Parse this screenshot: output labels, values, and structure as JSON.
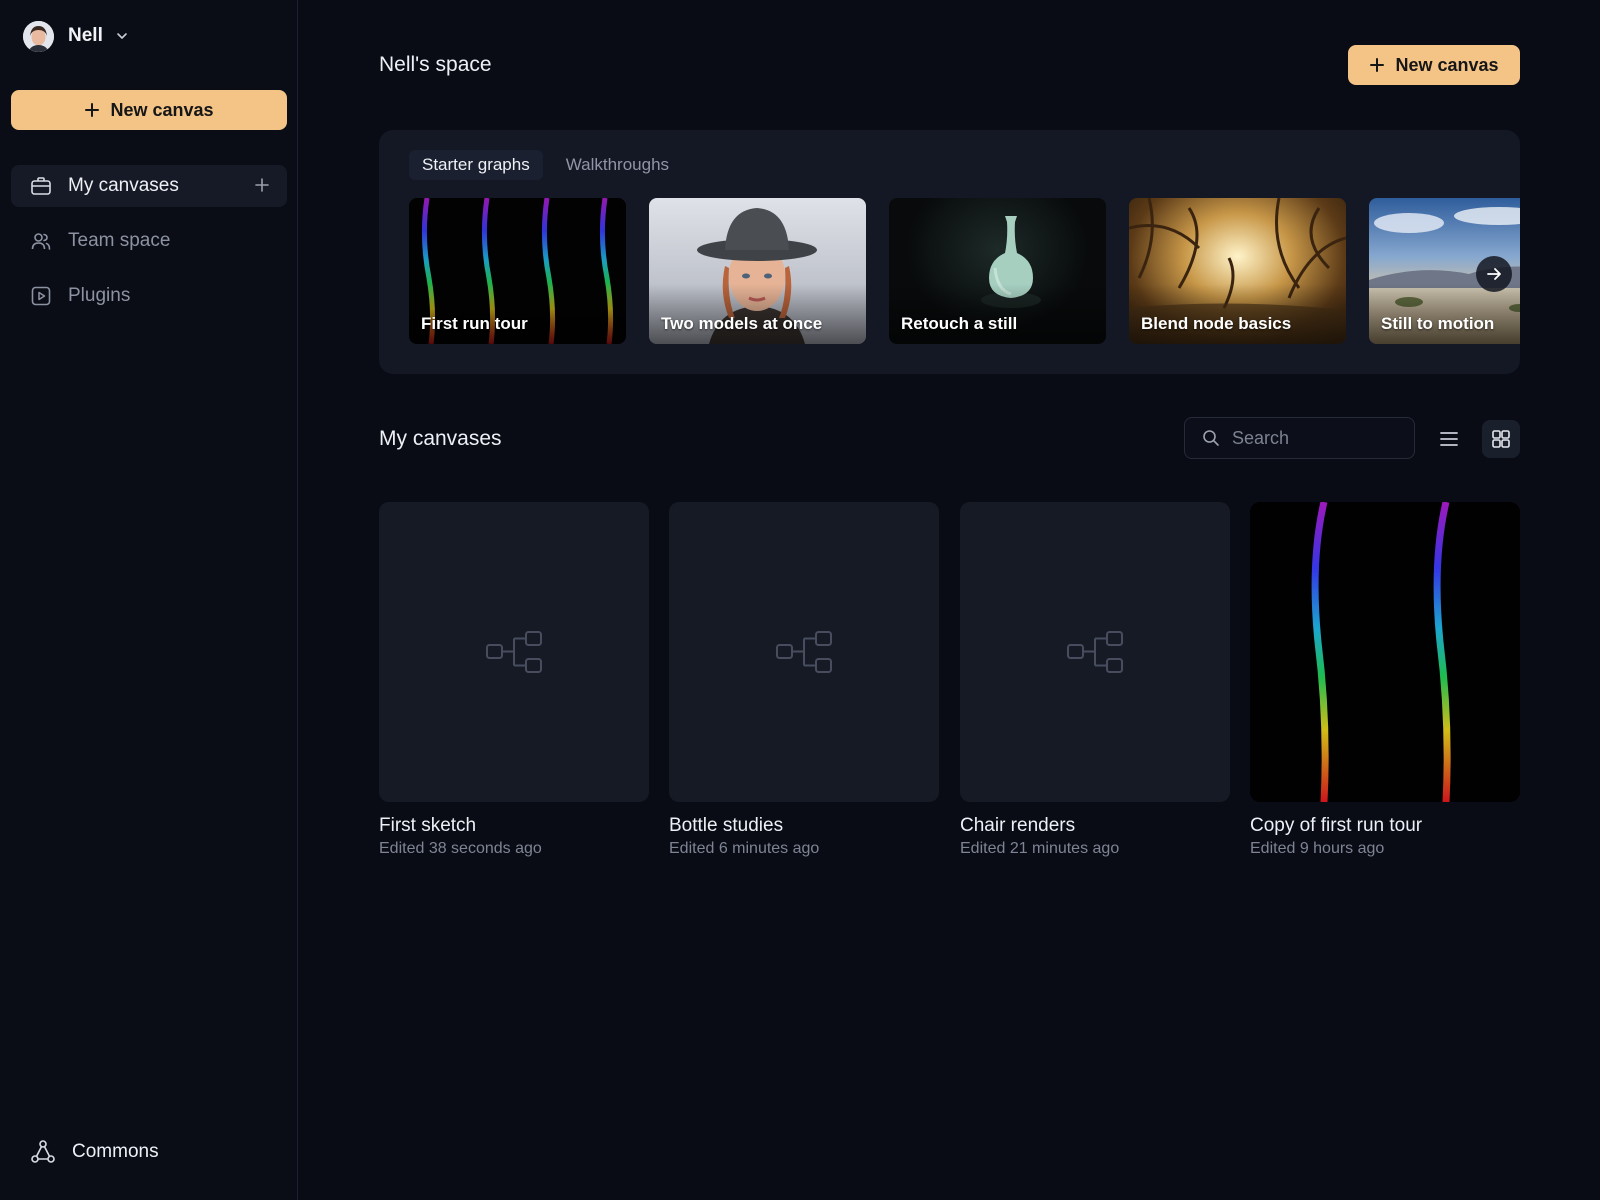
{
  "user": {
    "name": "Nell"
  },
  "sidebar": {
    "new_canvas_label": "New canvas",
    "items": [
      {
        "label": "My canvases",
        "icon": "briefcase-icon"
      },
      {
        "label": "Team space",
        "icon": "users-icon"
      },
      {
        "label": "Plugins",
        "icon": "play-square-icon"
      }
    ],
    "footer_label": "Commons"
  },
  "header": {
    "title": "Nell's space",
    "new_canvas_label": "New canvas"
  },
  "starter": {
    "tabs": [
      {
        "label": "Starter graphs"
      },
      {
        "label": "Walkthroughs"
      }
    ],
    "active_tab": "Starter graphs",
    "items": [
      {
        "label": "First run tour"
      },
      {
        "label": "Two models at once"
      },
      {
        "label": "Retouch a still"
      },
      {
        "label": "Blend node basics"
      },
      {
        "label": "Still to motion"
      }
    ]
  },
  "canvases": {
    "title": "My canvases",
    "search_placeholder": "Search",
    "view_mode": "grid",
    "items": [
      {
        "title": "First sketch",
        "subtitle": "Edited 38 seconds ago"
      },
      {
        "title": "Bottle studies",
        "subtitle": "Edited 6 minutes ago"
      },
      {
        "title": "Chair renders",
        "subtitle": "Edited 21 minutes ago"
      },
      {
        "title": "Copy of first run tour",
        "subtitle": "Edited 9 hours ago"
      }
    ]
  },
  "colors": {
    "accent": "#f4c487",
    "background": "#090c15",
    "panel": "#141824"
  }
}
